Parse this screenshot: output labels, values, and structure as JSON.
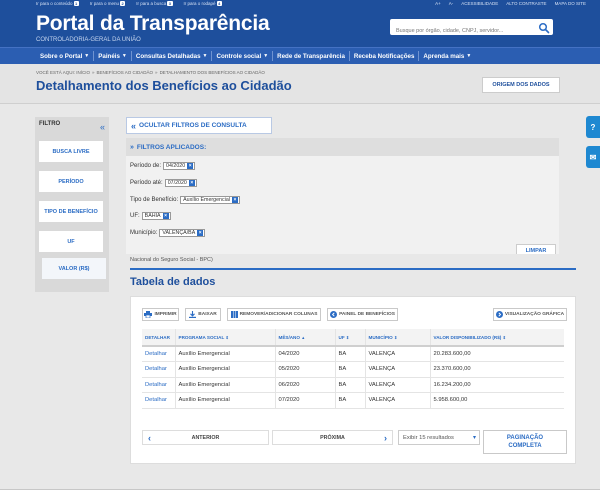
{
  "header": {
    "skip_links": [
      {
        "label": "Ir para o conteúdo",
        "key": "1"
      },
      {
        "label": "Ir para o menu",
        "key": "2"
      },
      {
        "label": "Ir para a busca",
        "key": "3"
      },
      {
        "label": "Ir para o rodapé",
        "key": "4"
      }
    ],
    "accessibility_links": [
      "A+",
      "A-",
      "ACESSIBILIDADE",
      "ALTO CONTRASTE",
      "MAPA DO SITE"
    ],
    "title": "Portal da Transparência",
    "subtitle": "CONTROLADORIA-GERAL DA UNIÃO",
    "search_placeholder": "Busque por órgão, cidade, CNPJ, servidor..."
  },
  "nav": {
    "items": [
      {
        "label": "Sobre o Portal",
        "caret": true
      },
      {
        "label": "Painéis",
        "caret": true
      },
      {
        "label": "Consultas Detalhadas",
        "caret": true
      },
      {
        "label": "Controle social",
        "caret": true
      },
      {
        "label": "Rede de Transparência",
        "caret": false
      },
      {
        "label": "Receba Notificações",
        "caret": false
      },
      {
        "label": "Aprenda mais",
        "caret": true
      }
    ]
  },
  "breadcrumb": [
    "VOCÊ ESTÁ AQUI: INÍCIO",
    "»",
    "BENEFÍCIOS AO CIDADÃO",
    "»",
    "DETALHAMENTO DOS BENEFÍCIOS AO CIDADÃO"
  ],
  "page_title": "Detalhamento dos Benefícios ao Cidadão",
  "origem_label": "ORIGEM DOS DADOS",
  "filter_panel": {
    "title": "FILTRO",
    "buttons": [
      "BUSCA LIVRE",
      "PERÍODO",
      "TIPO DE BENEFÍCIO",
      "UF",
      "VALOR (R$)"
    ]
  },
  "ocultar_label": "OCULTAR FILTROS DE CONSULTA",
  "filtros": {
    "title": "FILTROS APLICADOS:",
    "rows": [
      {
        "label": "Período de:",
        "value": "04/2020"
      },
      {
        "label": "Período até:",
        "value": "07/2020"
      },
      {
        "label": "Tipo de Benefício:",
        "value": "Auxílio Emergencial"
      },
      {
        "label": "UF:",
        "value": "BAHIA"
      },
      {
        "label": "Município:",
        "value": "VALENÇA/BA"
      }
    ],
    "limpar": "LIMPAR"
  },
  "data_source": "Nacional do Seguro Social - BPC)",
  "table_section": {
    "title": "Tabela de dados",
    "toolbar": {
      "imprimir": "IMPRIMIR",
      "baixar": "BAIXAR",
      "colunas": "REMOVER/ADICIONAR COLUNAS",
      "painel": "PAINEL DE BENEFÍCIOS",
      "grafica": "VISUALIZAÇÃO GRÁFICA"
    },
    "headers": [
      "DETALHAR",
      "PROGRAMA SOCIAL",
      "MÊS/ANO",
      "UF",
      "MUNICÍPIO",
      "VALOR DISPONIBILIZADO (R$)"
    ],
    "rows": [
      [
        "Detalhar",
        "Auxílio Emergencial",
        "04/2020",
        "BA",
        "VALENÇA",
        "20.283.600,00"
      ],
      [
        "Detalhar",
        "Auxílio Emergencial",
        "05/2020",
        "BA",
        "VALENÇA",
        "23.370.600,00"
      ],
      [
        "Detalhar",
        "Auxílio Emergencial",
        "06/2020",
        "BA",
        "VALENÇA",
        "16.234.200,00"
      ],
      [
        "Detalhar",
        "Auxílio Emergencial",
        "07/2020",
        "BA",
        "VALENÇA",
        "5.958.600,00"
      ]
    ],
    "pager": {
      "prev": "ANTERIOR",
      "next": "PRÓXIMA",
      "page_size": "Exibir 15 resultados",
      "completa_line1": "PAGINAÇÃO",
      "completa_line2": "COMPLETA"
    }
  },
  "side_icons": [
    "?",
    "✉"
  ],
  "colors": {
    "primary": "#1e4f9c",
    "nav": "#2b5eb2",
    "link": "#2b6cc4",
    "float": "#1e88d1"
  }
}
